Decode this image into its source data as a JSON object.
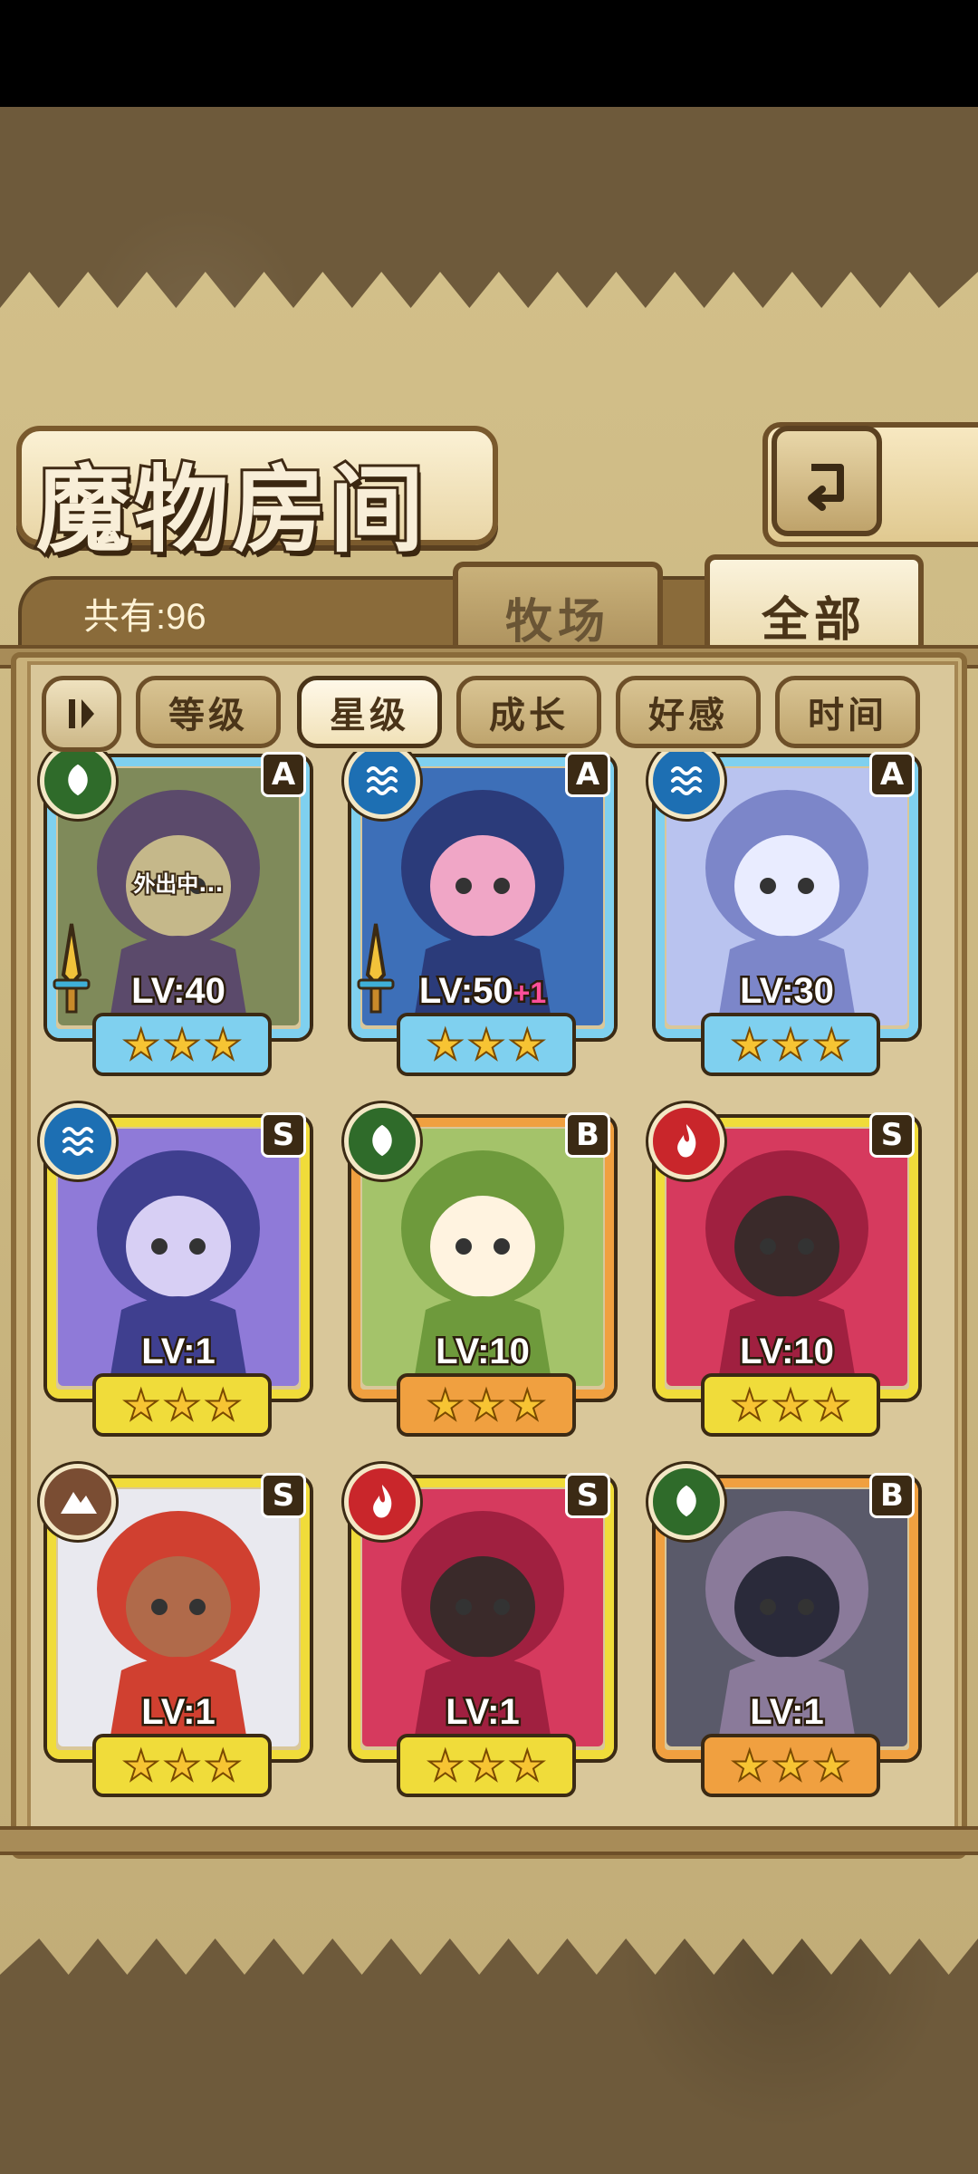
{
  "header": {
    "title": "魔物房间"
  },
  "count_label": "共有:96",
  "tabs": [
    {
      "label": "牧场",
      "active": false
    },
    {
      "label": "全部",
      "active": true
    }
  ],
  "sort_buttons": [
    {
      "label": "等级",
      "active": false
    },
    {
      "label": "星级",
      "active": true
    },
    {
      "label": "成长",
      "active": false
    },
    {
      "label": "好感",
      "active": false
    },
    {
      "label": "时间",
      "active": false
    }
  ],
  "cards": [
    {
      "element": "leaf",
      "rank": "A",
      "level": "LV:40",
      "bonus": "",
      "stars": 3,
      "frame": "blue",
      "status": "外出中...",
      "equipped": true
    },
    {
      "element": "water",
      "rank": "A",
      "level": "LV:50",
      "bonus": "+1",
      "stars": 3,
      "frame": "blue",
      "status": "",
      "equipped": true
    },
    {
      "element": "water",
      "rank": "A",
      "level": "LV:30",
      "bonus": "",
      "stars": 3,
      "frame": "blue",
      "status": "",
      "equipped": false
    },
    {
      "element": "water",
      "rank": "S",
      "level": "LV:1",
      "bonus": "",
      "stars": 3,
      "frame": "gold",
      "status": "",
      "equipped": false
    },
    {
      "element": "leaf",
      "rank": "B",
      "level": "LV:10",
      "bonus": "",
      "stars": 3,
      "frame": "orange",
      "status": "",
      "equipped": false
    },
    {
      "element": "fire",
      "rank": "S",
      "level": "LV:10",
      "bonus": "",
      "stars": 3,
      "frame": "gold",
      "status": "",
      "equipped": false
    },
    {
      "element": "earth",
      "rank": "S",
      "level": "LV:1",
      "bonus": "",
      "stars": 3,
      "frame": "gold",
      "status": "",
      "equipped": false
    },
    {
      "element": "fire",
      "rank": "S",
      "level": "LV:1",
      "bonus": "",
      "stars": 3,
      "frame": "gold",
      "status": "",
      "equipped": false
    },
    {
      "element": "leaf",
      "rank": "B",
      "level": "LV:1",
      "bonus": "",
      "stars": 3,
      "frame": "orange",
      "status": "",
      "equipped": false
    }
  ],
  "colors": {
    "blue": "#7fd0ef",
    "gold": "#f0dc3a",
    "orange": "#f0a040",
    "leaf": "#2f6b2a",
    "water": "#1d6fb3",
    "fire": "#c9262b",
    "earth": "#7a4d33"
  }
}
